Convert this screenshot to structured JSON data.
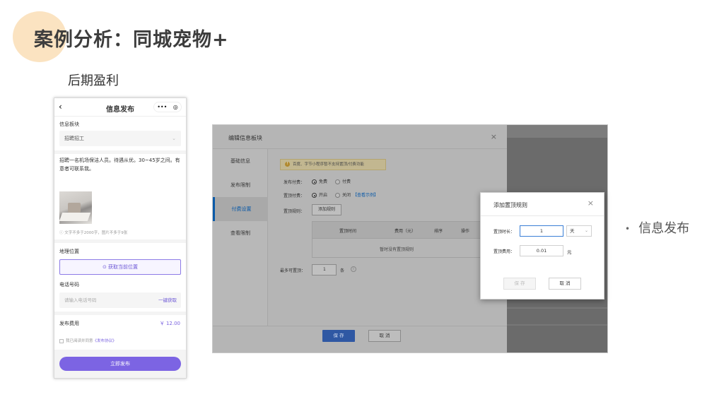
{
  "slide": {
    "title": "案例分析：同城宠物+",
    "subtitle": "后期盈利",
    "bullet": "信息发布"
  },
  "phone": {
    "back_icon": "‹",
    "title": "信息发布",
    "capsule_more": "•••",
    "capsule_target": "◎",
    "board_label": "信息板块",
    "board_value": "招聘招工",
    "description": "招聘一名机场保洁人员。待遇从优。30~45岁之间。有意者可联系我。",
    "hint": "文字不多于2000字，图片不多于9张",
    "location_label": "地理位置",
    "location_button": "获取当前位置",
    "phone_label": "电话号码",
    "phone_placeholder": "请输入电话号码",
    "phone_get": "一键获取",
    "fee_label": "发布费用",
    "fee_value": "￥ 12.00",
    "agree_prefix": "我已阅读并同意",
    "agree_link": "《发布协议》",
    "submit": "立即发布"
  },
  "editor": {
    "title": "编辑信息板块",
    "close": "×",
    "sidebar": [
      {
        "label": "基础信息",
        "active": false
      },
      {
        "label": "发布限制",
        "active": false
      },
      {
        "label": "付费设置",
        "active": true
      },
      {
        "label": "查看限制",
        "active": false
      }
    ],
    "notice": "百度、字节小程序暂不支持置顶/付费功能",
    "publish_fee_label": "发布付费：",
    "publish_fee_options": [
      "免费",
      "付费"
    ],
    "pin_fee_label": "置顶付费：",
    "pin_fee_options": [
      "开启",
      "关闭"
    ],
    "pin_fee_example": "【查看示例】",
    "pin_rule_label": "置顶规则：",
    "add_rule_button": "添加规则",
    "table_headers": [
      "置顶时间",
      "费用（元）",
      "排序",
      "操作"
    ],
    "table_empty": "暂时没有置顶规则",
    "max_pin_label": "最多可置顶：",
    "max_pin_value": "1",
    "max_pin_unit": "条",
    "save_button": "保 存",
    "cancel_button": "取 消"
  },
  "pin_dialog": {
    "title": "添加置顶规则",
    "close": "×",
    "duration_label": "置顶时长：",
    "duration_value": "1",
    "duration_unit": "天",
    "fee_label": "置顶费用：",
    "fee_value": "0.01",
    "fee_unit": "元",
    "save_button": "保 存",
    "cancel_button": "取 消"
  },
  "colors": {
    "accent_purple": "#7c64e3",
    "deco_circle": "#fbe3c1",
    "primary_blue": "#2f58a3"
  }
}
